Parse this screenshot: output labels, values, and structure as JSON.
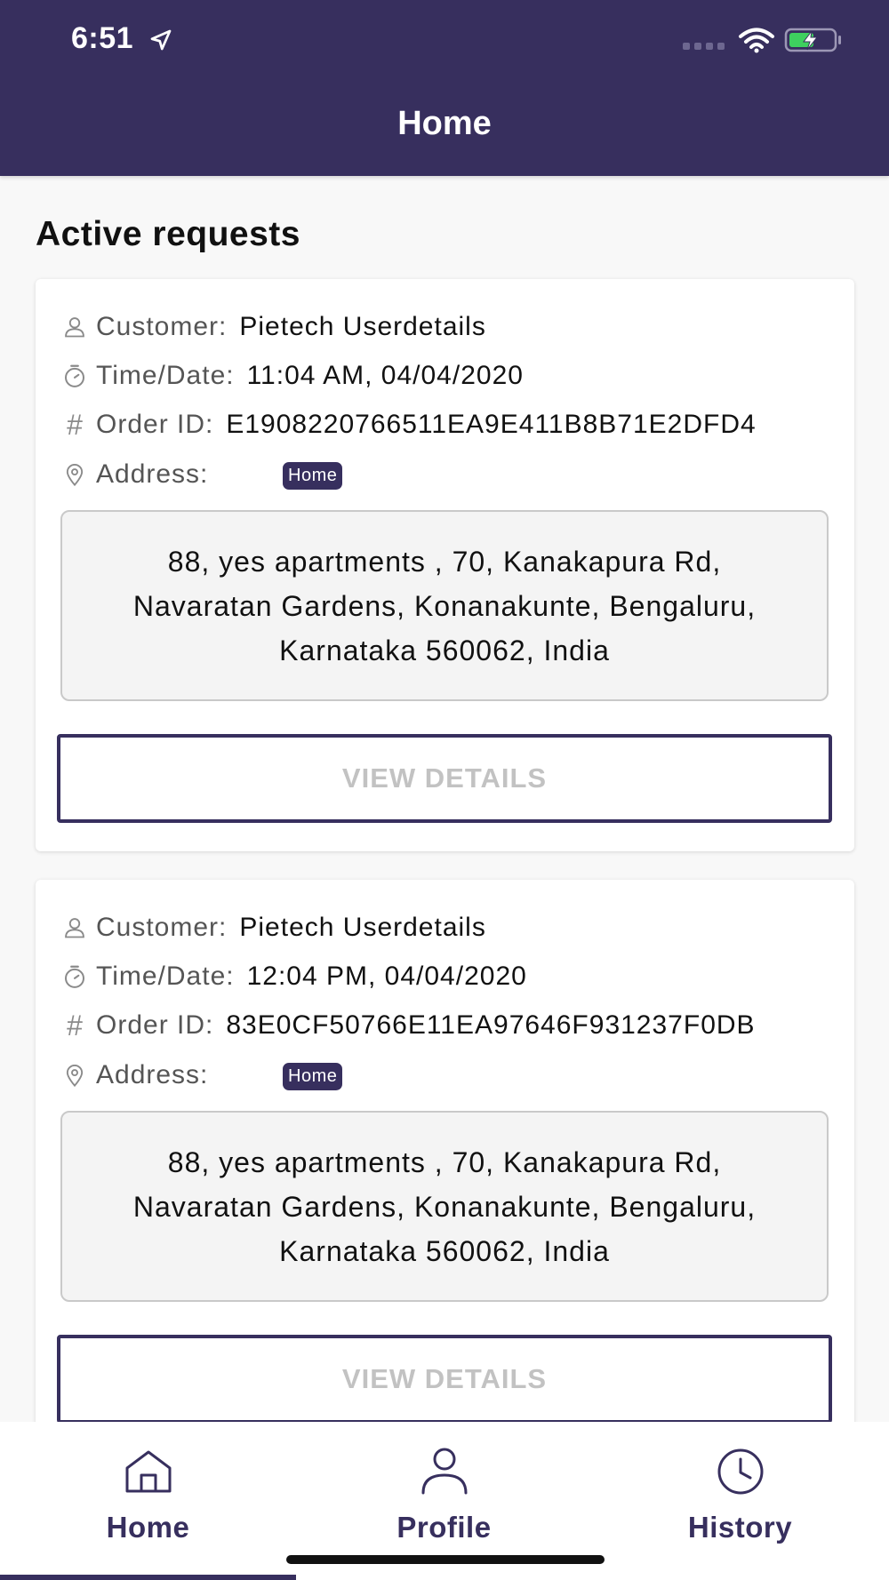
{
  "status_bar": {
    "time": "6:51",
    "location_icon": "location-arrow-icon",
    "wifi_icon": "wifi-icon",
    "battery_icon": "battery-charging-icon"
  },
  "header": {
    "title": "Home"
  },
  "section": {
    "title": "Active requests"
  },
  "requests": [
    {
      "customer_label": "Customer:",
      "customer_value": "Pietech Userdetails",
      "time_label": "Time/Date:",
      "time_value": "11:04 AM, 04/04/2020",
      "order_label": "Order ID:",
      "order_value": "E1908220766511EA9E411B8B71E2DFD4",
      "address_label": "Address:",
      "address_badge": "Home",
      "address_text": "88, yes apartments , 70, Kanakapura Rd, Navaratan Gardens, Konanakunte, Bengaluru, Karnataka 560062, India",
      "button_label": "VIEW DETAILS"
    },
    {
      "customer_label": "Customer:",
      "customer_value": "Pietech Userdetails",
      "time_label": "Time/Date:",
      "time_value": "12:04 PM, 04/04/2020",
      "order_label": "Order ID:",
      "order_value": "83E0CF50766E11EA97646F931237F0DB",
      "address_label": "Address:",
      "address_badge": "Home",
      "address_text": "88, yes apartments , 70, Kanakapura Rd, Navaratan Gardens, Konanakunte, Bengaluru, Karnataka 560062, India",
      "button_label": "VIEW DETAILS"
    }
  ],
  "tab_bar": {
    "tabs": [
      {
        "label": "Home",
        "icon": "home-icon",
        "selected": true
      },
      {
        "label": "Profile",
        "icon": "profile-icon",
        "selected": false
      },
      {
        "label": "History",
        "icon": "clock-icon",
        "selected": false
      }
    ]
  },
  "colors": {
    "primary": "#372f5e",
    "button_text_disabled": "#c2c2c2",
    "background": "#f8f8f8"
  }
}
